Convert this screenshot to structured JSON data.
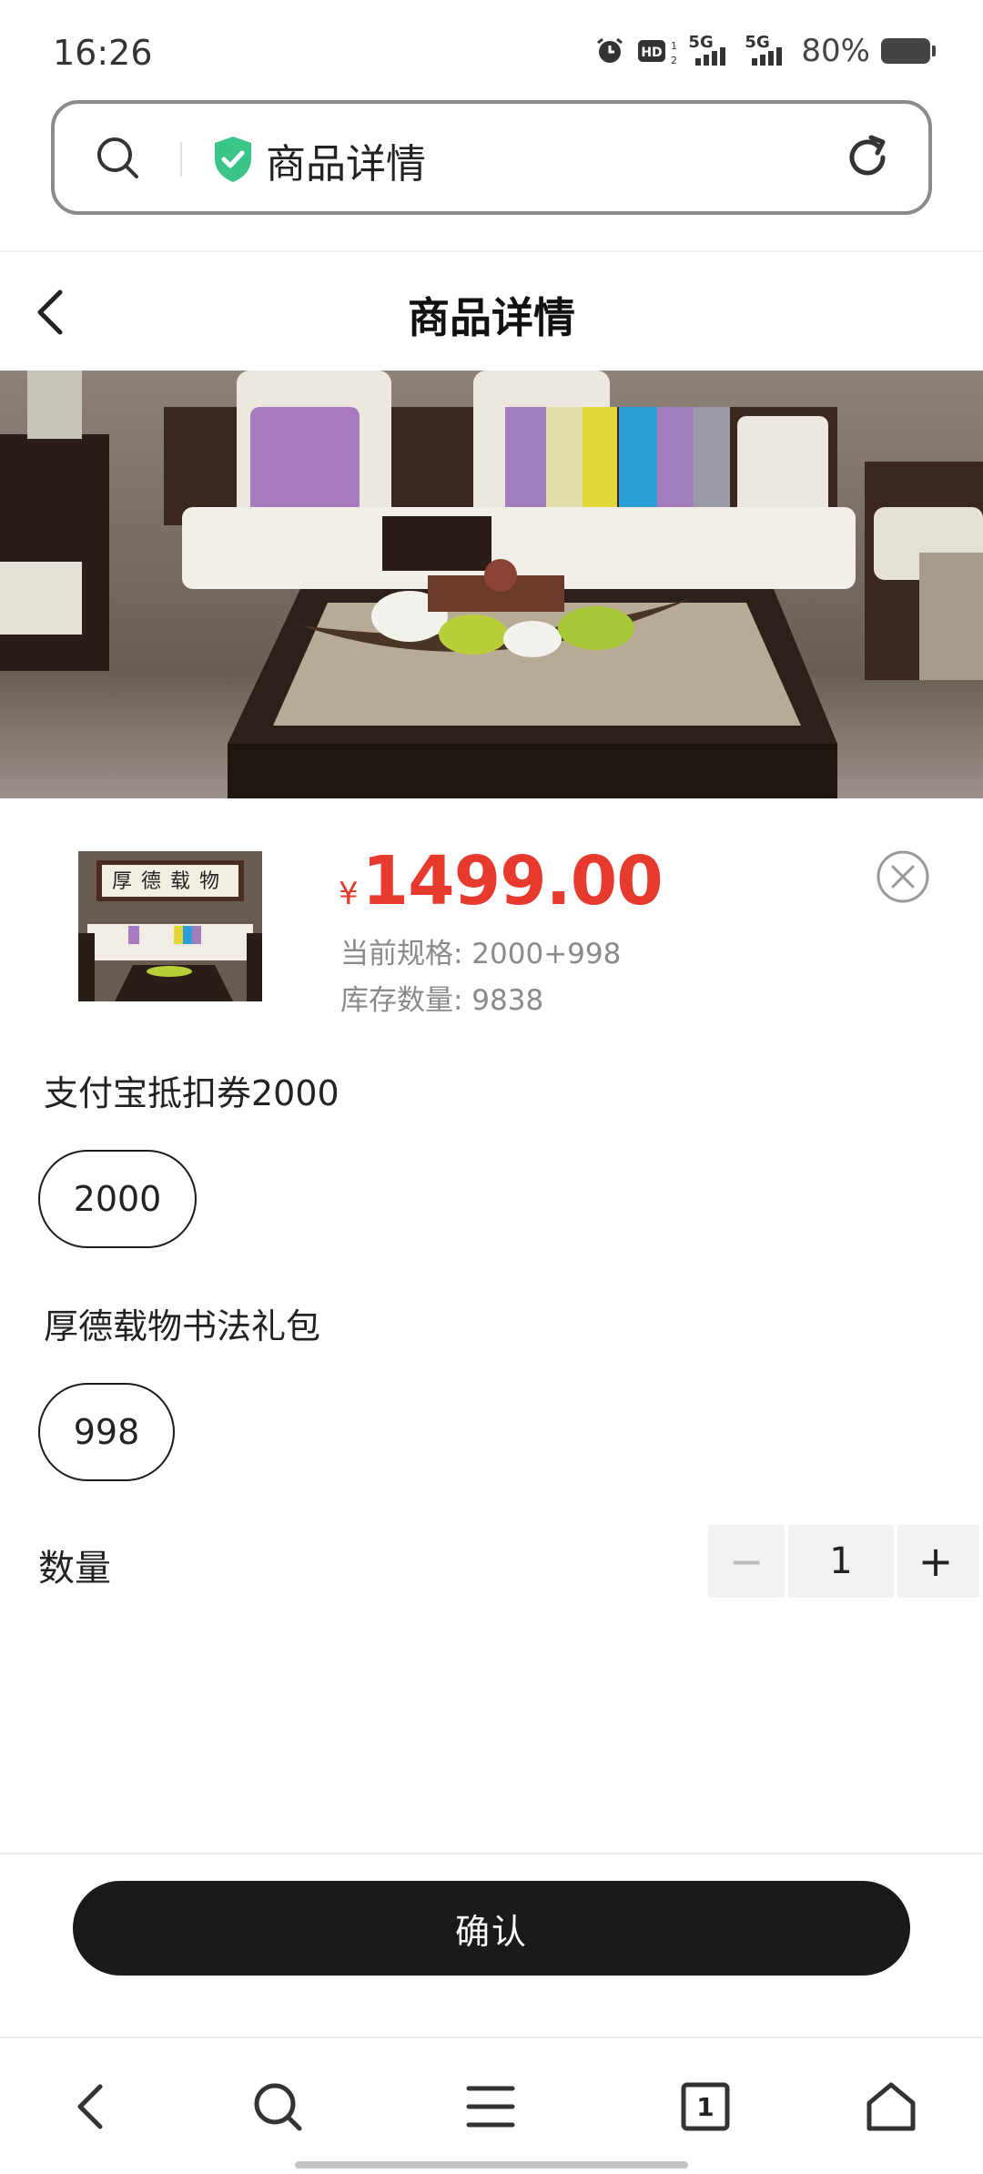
{
  "status_bar": {
    "time": "16:26",
    "network_1": "5G",
    "network_2": "5G",
    "hd_label": "HD",
    "battery": "80%"
  },
  "url_bar": {
    "title": "商品详情",
    "icons": [
      "search-icon",
      "shield-check-icon",
      "refresh-icon"
    ],
    "shield_color": "#3bc488"
  },
  "header": {
    "title": "商品详情",
    "back_icon": "chevron-left-icon"
  },
  "product": {
    "currency_symbol": "¥",
    "price": "1499.00",
    "spec_line": "当前规格: 2000+998",
    "stock_line": "库存数量:  9838",
    "price_color": "#e63a2e"
  },
  "options": [
    {
      "label": "支付宝抵扣券2000",
      "value": "2000"
    },
    {
      "label": "厚德载物书法礼包",
      "value": "998"
    }
  ],
  "quantity": {
    "label": "数量",
    "minus": "−",
    "value": "1",
    "plus": "+"
  },
  "confirm": {
    "label": "确认"
  },
  "toolbar": {
    "tab_count": "1",
    "icons": [
      "back-icon",
      "search-icon",
      "menu-icon",
      "tabs-icon",
      "home-icon"
    ]
  },
  "thumbnail": {
    "calligraphy": "厚德载物"
  }
}
